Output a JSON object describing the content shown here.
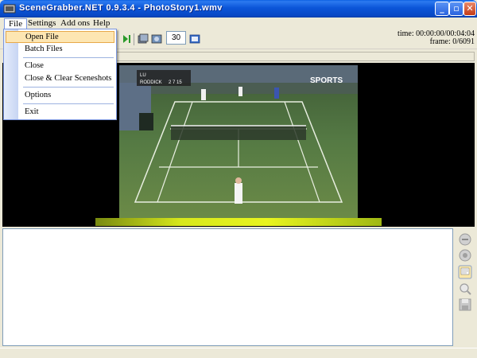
{
  "window": {
    "title": "SceneGrabber.NET 0.9.3.4 - PhotoStory1.wmv",
    "controls": {
      "minimize": "_",
      "maximize": "▫",
      "close": "✕"
    }
  },
  "menubar": {
    "items": [
      {
        "label": "File"
      },
      {
        "label": "Settings"
      },
      {
        "label": "Add ons"
      },
      {
        "label": "Help"
      }
    ]
  },
  "file_menu": {
    "items": [
      {
        "label": "Open File",
        "hovered": true
      },
      {
        "label": "Batch Files"
      },
      {
        "label": "Close"
      },
      {
        "label": "Close & Clear Sceneshots"
      },
      {
        "label": "Options"
      },
      {
        "label": "Exit"
      }
    ]
  },
  "toolbar": {
    "frames_per_step": "30",
    "icons": [
      "play-end-icon",
      "capture-icon",
      "capture-all-icon",
      "help-book-icon"
    ]
  },
  "status": {
    "time": "time: 00:00:00/00:04:04",
    "frame": "frame: 0/6091"
  },
  "video": {
    "scoreboard_name": "RODDICK",
    "scoreboard_score": "2  7  15",
    "scoreboard_other": "LU",
    "watermark": "SPORTS"
  },
  "side_tools": {
    "icons": [
      "remove-icon",
      "remove-all-icon",
      "save-icon",
      "zoom-icon",
      "disk-icon"
    ]
  },
  "colors": {
    "titlebar": "#0b55d8",
    "menu_hover": "#fde6b2",
    "court": "#4f7040"
  }
}
